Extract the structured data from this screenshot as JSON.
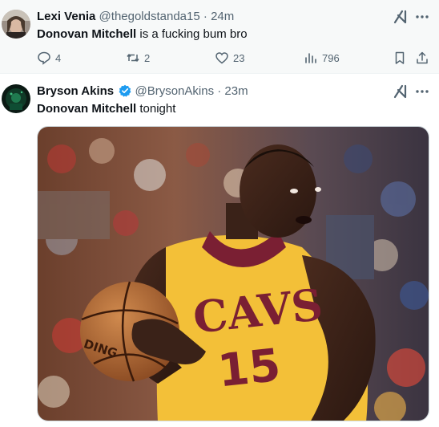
{
  "tweets": [
    {
      "author_name": "Lexi Venia",
      "handle": "@thegoldstanda15",
      "separator": "·",
      "time": "24m",
      "text_bold": "Donovan Mitchell",
      "text_rest": " is a fucking bum bro",
      "replies": "4",
      "reposts": "2",
      "likes": "23",
      "views": "796"
    },
    {
      "author_name": "Bryson Akins",
      "handle": "@BrysonAkins",
      "separator": "·",
      "time": "23m",
      "text_bold": "Donovan Mitchell",
      "text_rest": " tonight",
      "photo": {
        "jersey_text": "CAVS",
        "jersey_number": "15",
        "ball_text": "DING"
      }
    }
  ],
  "icons": {
    "grok": "grok-icon",
    "more": "more-icon",
    "reply": "reply-icon",
    "repost": "repost-icon",
    "like": "like-icon",
    "views": "views-icon",
    "bookmark": "bookmark-icon",
    "share": "share-icon",
    "verified": "verified-badge-icon"
  },
  "colors": {
    "text_primary": "#0f1419",
    "text_secondary": "#536471",
    "verified_blue": "#1d9bf0",
    "jersey_gold": "#f3c038",
    "jersey_wine": "#7a1f33"
  }
}
